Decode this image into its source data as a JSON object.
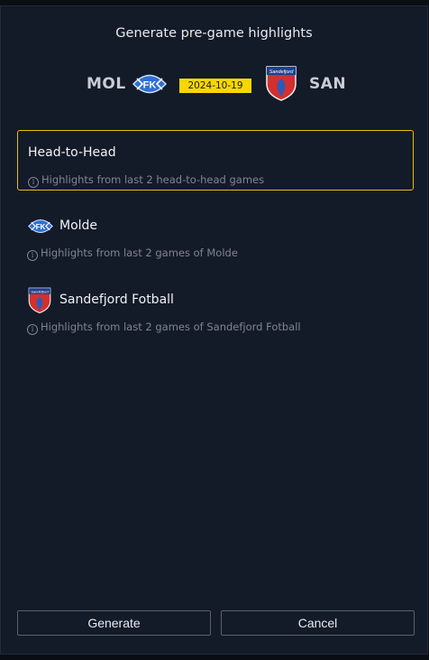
{
  "dialog": {
    "title": "Generate pre-game highlights"
  },
  "match": {
    "home_abbr": "MOL",
    "away_abbr": "SAN",
    "date": "2024-10-19",
    "home_logo_text": "FK",
    "away_logo_text": "Sandefjord"
  },
  "options": [
    {
      "label": "Head-to-Head",
      "description": "Highlights from last 2 head-to-head games",
      "selected": true
    },
    {
      "label": "Molde",
      "description": "Highlights from last 2 games of Molde",
      "icon": "molde-logo-icon",
      "selected": false
    },
    {
      "label": "Sandefjord Fotball",
      "description": "Highlights from last 2 games of Sandefjord Fotball",
      "icon": "sandefjord-logo-icon",
      "selected": false
    }
  ],
  "info_icon_glyph": "i",
  "buttons": {
    "generate": "Generate",
    "cancel": "Cancel"
  },
  "colors": {
    "accent": "#f7d700",
    "selected_border": "#e3c400",
    "dialog_bg": "#131a28",
    "molde_blue": "#2f6fd3",
    "sandefjord_red": "#d32f2f"
  }
}
